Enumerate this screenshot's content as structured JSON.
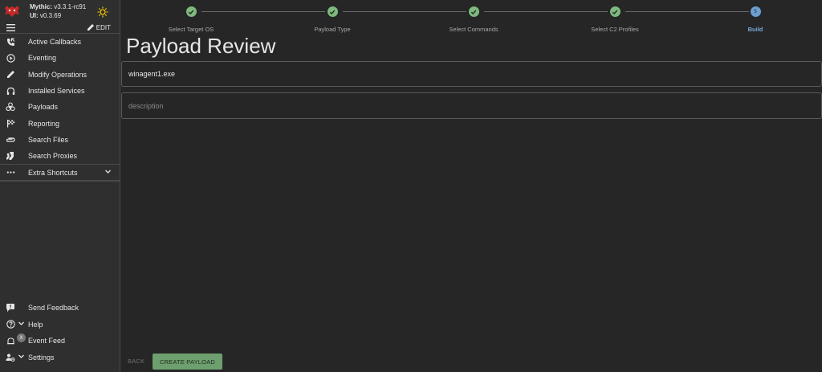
{
  "app": {
    "version_label": "Mythic:",
    "version_value": "v3.3.1-rc91",
    "ui_label": "UI:",
    "ui_value": "v0.3.69",
    "edit_label": "EDIT"
  },
  "sidebar": {
    "items": [
      {
        "label": "Active Callbacks",
        "icon": "phone-callback-icon"
      },
      {
        "label": "Eventing",
        "icon": "play-circle-icon"
      },
      {
        "label": "Modify Operations",
        "icon": "pencil-icon"
      },
      {
        "label": "Installed Services",
        "icon": "headphones-icon"
      },
      {
        "label": "Payloads",
        "icon": "biohazard-icon"
      },
      {
        "label": "Reporting",
        "icon": "flag-icon"
      },
      {
        "label": "Search Files",
        "icon": "attachment-icon"
      },
      {
        "label": "Search Proxies",
        "icon": "socks-icon"
      }
    ],
    "shortcuts_label": "Extra Shortcuts",
    "bottom": [
      {
        "label": "Send Feedback",
        "icon": "feedback-icon"
      },
      {
        "label": "Help",
        "icon": "help-icon"
      },
      {
        "label": "Event Feed",
        "icon": "bell-icon",
        "badge": "X"
      },
      {
        "label": "Settings",
        "icon": "settings-icon"
      }
    ]
  },
  "stepper": {
    "steps": [
      {
        "label": "Select Target OS",
        "state": "complete"
      },
      {
        "label": "Payload Type",
        "state": "complete"
      },
      {
        "label": "Select Commands",
        "state": "complete"
      },
      {
        "label": "Select C2 Profiles",
        "state": "complete"
      },
      {
        "label": "Build",
        "state": "active",
        "number": "5"
      }
    ]
  },
  "main": {
    "title": "Payload Review",
    "filename_value": "winagent1.exe",
    "description_placeholder": "description",
    "back_label": "BACK",
    "create_label": "CREATE PAYLOAD"
  },
  "colors": {
    "complete": "#7eb97e",
    "active": "#6c9fcf",
    "create_button": "#6e9f6e",
    "background": "#262626",
    "sidebar": "#2f2f2f"
  }
}
